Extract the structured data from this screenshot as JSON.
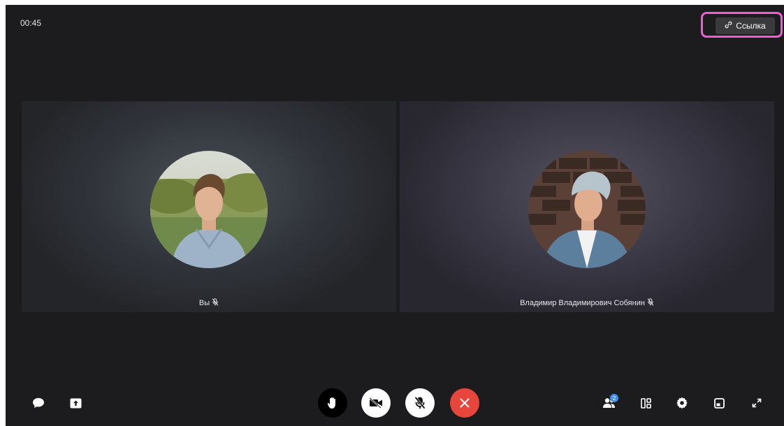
{
  "call": {
    "timer": "00:45",
    "link_button": {
      "label": "Ссылка",
      "icon": "link-icon"
    },
    "highlight_color": "#f05cd2"
  },
  "participants": [
    {
      "label": "Вы",
      "muted": true,
      "icon": "mic-off-icon"
    },
    {
      "label": "Владимир Владимирович Собянин",
      "muted": true,
      "icon": "mic-off-icon"
    }
  ],
  "controls": {
    "left": [
      {
        "name": "chat-icon"
      },
      {
        "name": "screen-share-icon"
      }
    ],
    "center": [
      {
        "name": "raise-hand-icon",
        "bg": "#000000"
      },
      {
        "name": "camera-off-icon",
        "bg": "#ffffff"
      },
      {
        "name": "mic-off-icon",
        "bg": "#ffffff"
      },
      {
        "name": "end-call-icon",
        "bg": "#e8453c"
      }
    ],
    "right": [
      {
        "name": "participants-icon",
        "badge": "2"
      },
      {
        "name": "layout-icon"
      },
      {
        "name": "settings-icon"
      },
      {
        "name": "picture-in-picture-icon"
      },
      {
        "name": "fullscreen-icon"
      }
    ]
  }
}
